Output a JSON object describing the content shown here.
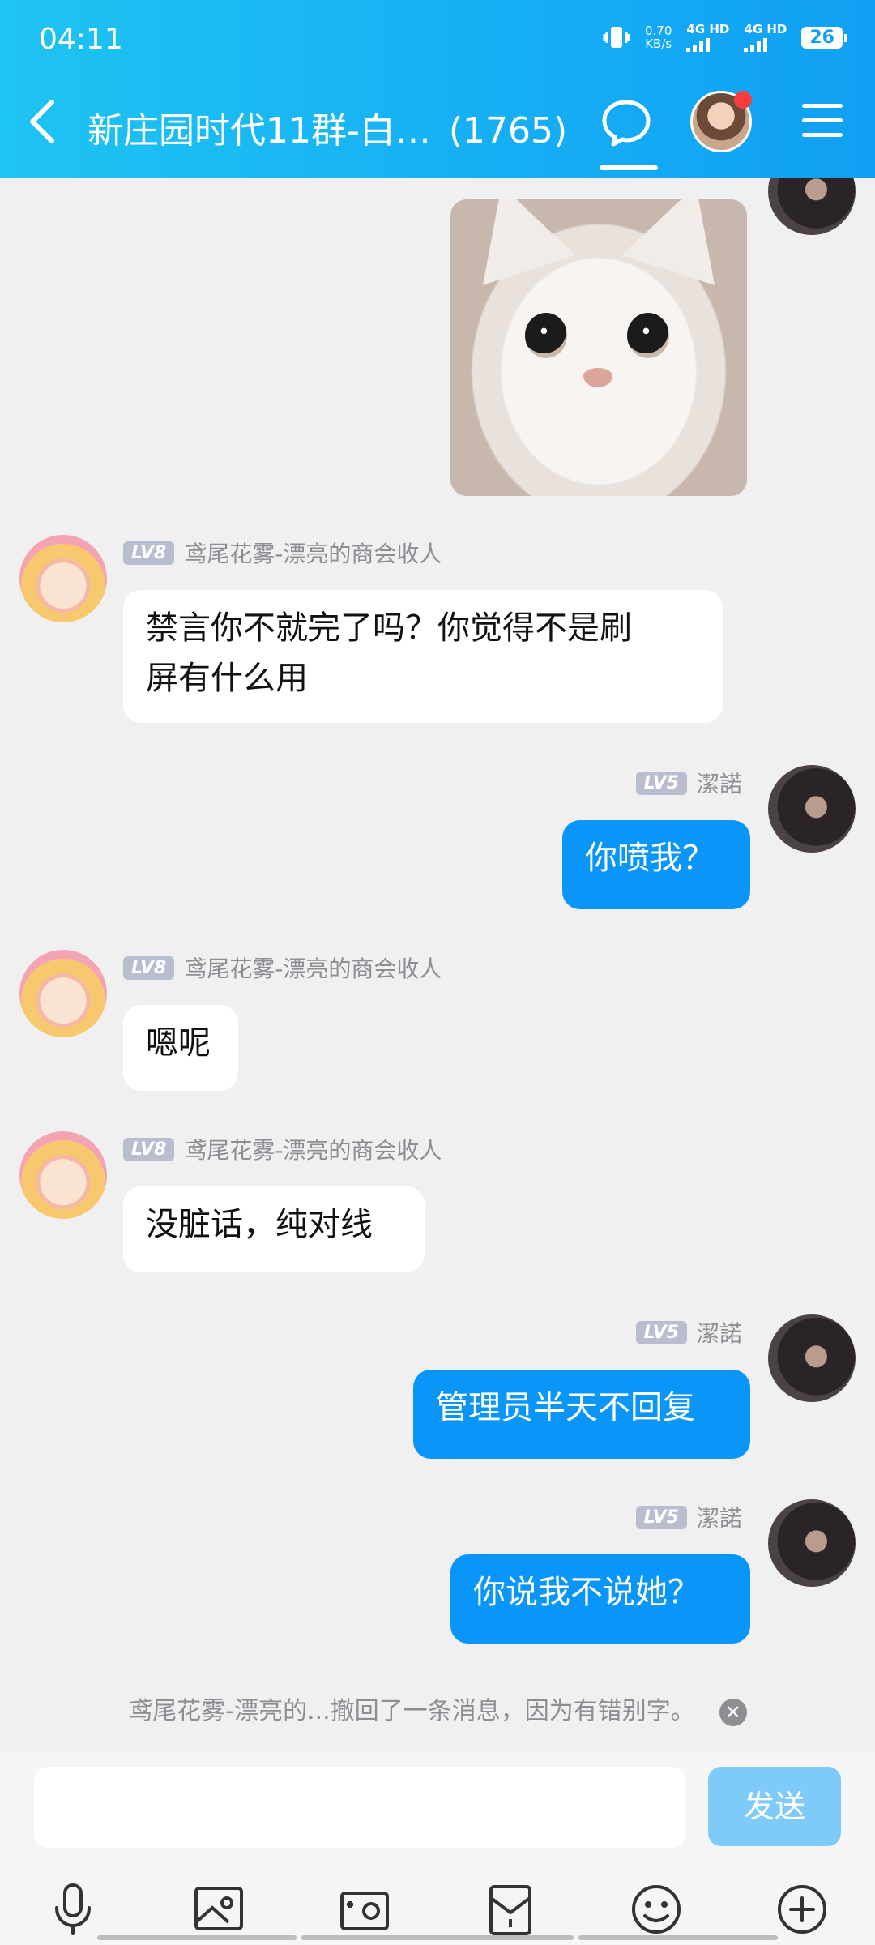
{
  "status_bar": {
    "time": "04:11",
    "net_speed": "0.70",
    "net_unit": "KB/s",
    "network1": "4G HD",
    "network2": "4G HD",
    "battery": "26"
  },
  "header": {
    "title": "新庄园时代11群-白…",
    "member_count": "(1765)",
    "icons": [
      "back-icon",
      "chat-bubble-icon",
      "avatar",
      "menu-icon"
    ],
    "accent": "#10a0f3",
    "notify_color": "#fa3c3c"
  },
  "messages": [
    {
      "from": "me",
      "type": "image",
      "content": "cat-sticker"
    },
    {
      "from": "other",
      "level": "LV8",
      "sender": "鸢尾花雾-漂亮的商会收人",
      "text_line1": "禁言你不就完了吗？你觉得不是刷",
      "text_line2": "屏有什么用"
    },
    {
      "from": "me",
      "level": "LV5",
      "sender": "潔諾",
      "text": "你喷我？"
    },
    {
      "from": "other",
      "level": "LV8",
      "sender": "鸢尾花雾-漂亮的商会收人",
      "text": "嗯呢"
    },
    {
      "from": "other",
      "level": "LV8",
      "sender": "鸢尾花雾-漂亮的商会收人",
      "text": "没脏话，纯对线"
    },
    {
      "from": "me",
      "level": "LV5",
      "sender": "潔諾",
      "text": "管理员半天不回复"
    },
    {
      "from": "me",
      "level": "LV5",
      "sender": "潔諾",
      "text": "你说我不说她？"
    }
  ],
  "recall_notice": "鸢尾花雾-漂亮的...撤回了一条消息，因为有错别字。",
  "input": {
    "value": "",
    "send_label": "发送"
  },
  "toolbar": [
    "microphone-icon",
    "photo-icon",
    "camera-icon",
    "red-packet-icon",
    "emoji-icon",
    "plus-icon"
  ],
  "colors": {
    "outgoing_bubble": "#0996f8",
    "incoming_bubble": "#ffffff",
    "send_button": "#7ecbfa"
  }
}
